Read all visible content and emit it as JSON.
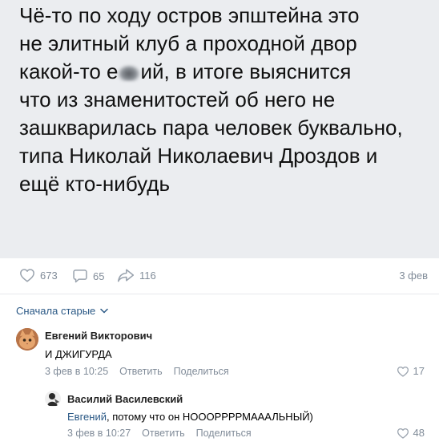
{
  "post": {
    "lines": [
      "Чё-то по ходу остров эпштейна это",
      "не элитный клуб а проходной двор",
      "какой-то е",
      "ий, в итоге выяснится",
      "что из знаменитостей об него не",
      "зашкварилась пара человек буквально,",
      "типа Николай Николаевич Дроздов и",
      "ещё кто-нибудь"
    ],
    "likes": "673",
    "comments": "65",
    "shares": "116",
    "date": "3 фев"
  },
  "sort_label": "Сначала старые",
  "comments": [
    {
      "author": "Евгений Викторович",
      "text": "И ДЖИГУРДА",
      "date": "3 фев в 10:25",
      "reply": "Ответить",
      "share": "Поделиться",
      "likes": "17"
    },
    {
      "author": "Василий Василевский",
      "mention": "Евгений",
      "text": ", потому что он НОООРРРРМАААЛЬНЫЙ)",
      "date": "3 фев в 10:27",
      "reply": "Ответить",
      "share": "Поделиться",
      "likes": "48"
    }
  ],
  "colors": {
    "link": "#2a5885",
    "meta": "#818c99",
    "post_bg": "#ebedf0"
  }
}
